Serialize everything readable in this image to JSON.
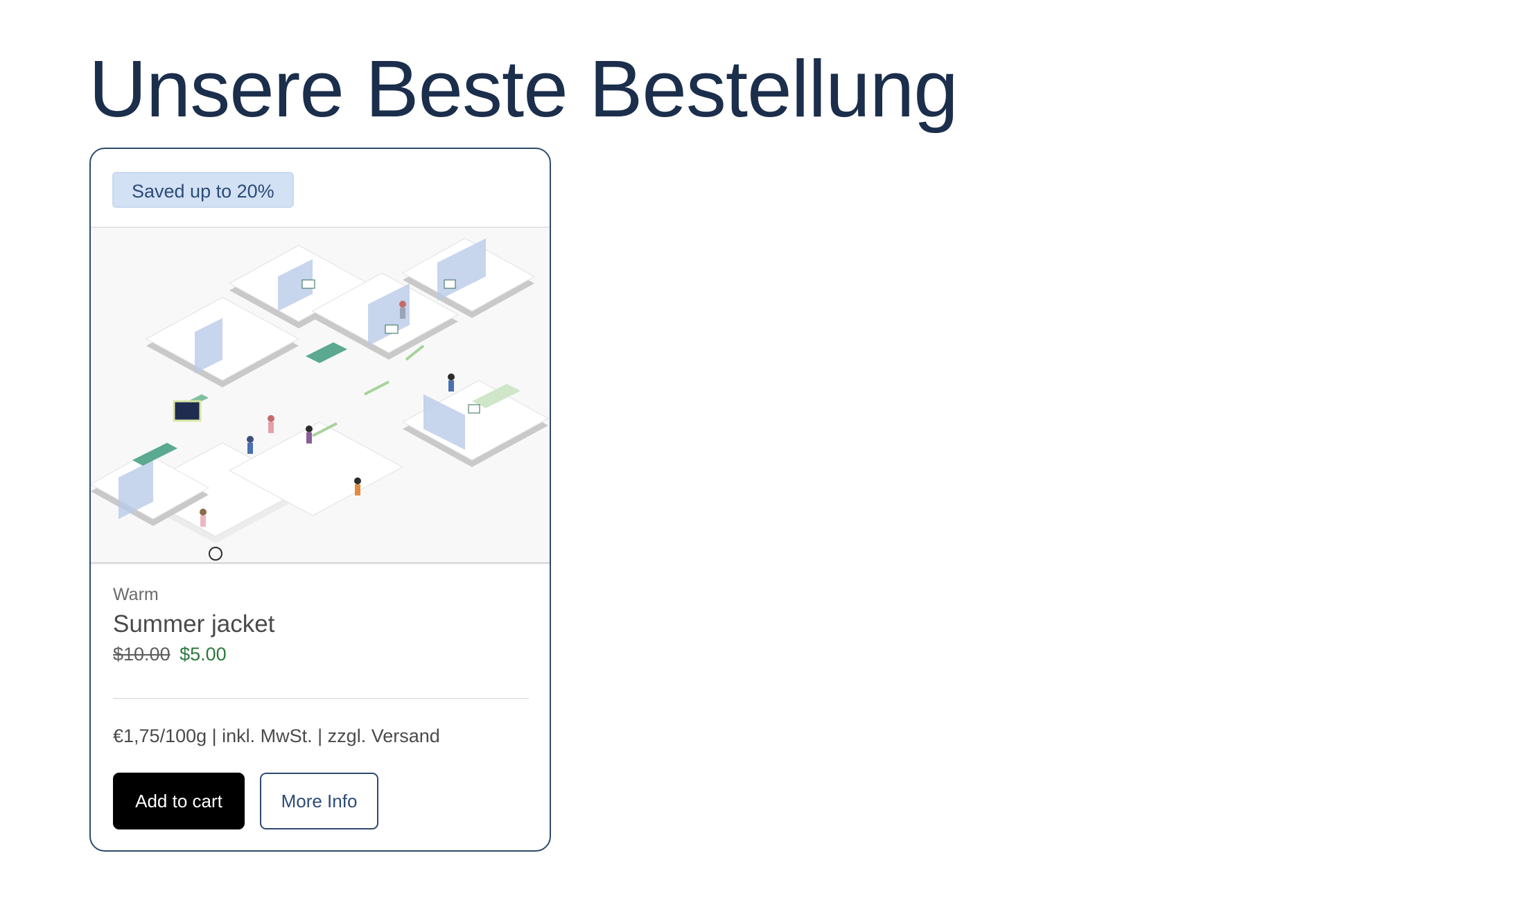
{
  "page": {
    "title": "Unsere Beste Bestellung"
  },
  "product_card": {
    "badge": "Saved up to 20%",
    "image_icon": "isometric-hospital-floorplan-illustration",
    "eyebrow": "Warm",
    "title": "Summer jacket",
    "original_price": "$10.00",
    "sale_price": "$5.00",
    "unit_info": "€1,75/100g | inkl. MwSt. | zzgl. Versand",
    "add_to_cart_label": "Add to cart",
    "more_info_label": "More Info"
  },
  "colors": {
    "title": "#1b2e4b",
    "badge_bg": "#d2e1f4",
    "badge_text": "#2c4b78",
    "sale_price": "#2b7a3e",
    "primary_button": "#000000",
    "card_border": "#2d4a6b"
  }
}
